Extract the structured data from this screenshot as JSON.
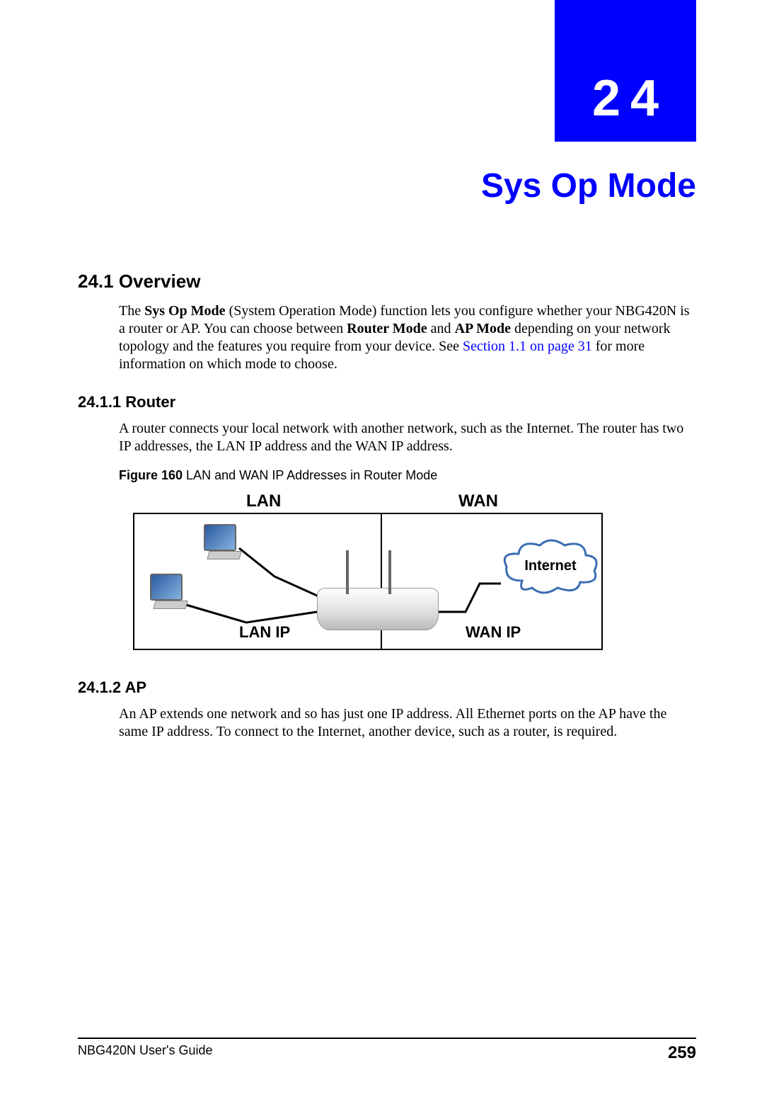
{
  "chapter": {
    "number": "24",
    "title": "Sys Op Mode"
  },
  "sections": {
    "s1": {
      "heading": "24.1  Overview",
      "para_prefix": "The ",
      "bold1": "Sys Op Mode",
      "para_mid1": " (System Operation Mode) function lets you configure whether your NBG420N is a router or AP. You can choose between ",
      "bold2": "Router Mode",
      "para_mid2": " and ",
      "bold3": "AP Mode",
      "para_mid3": " depending on your network topology and the features you require from your device. See ",
      "link": "Section 1.1 on page 31",
      "para_suffix": " for more information on which mode to choose."
    },
    "s1_1": {
      "heading": "24.1.1  Router",
      "para": "A router connects your local network with another network, such as the Internet. The router has two IP addresses, the LAN IP address and the WAN IP address."
    },
    "figure": {
      "label_bold": "Figure 160   ",
      "label_rest": "LAN and WAN IP Addresses in Router Mode",
      "lan": "LAN",
      "wan": "WAN",
      "lan_ip": "LAN IP",
      "wan_ip": "WAN IP",
      "internet": "Internet"
    },
    "s1_2": {
      "heading": "24.1.2  AP",
      "para": "An AP extends one network and so has just one IP address. All Ethernet ports on the AP have the same IP address. To connect to the Internet, another device, such as a router, is required."
    }
  },
  "footer": {
    "guide": "NBG420N User's Guide",
    "page": "259"
  }
}
